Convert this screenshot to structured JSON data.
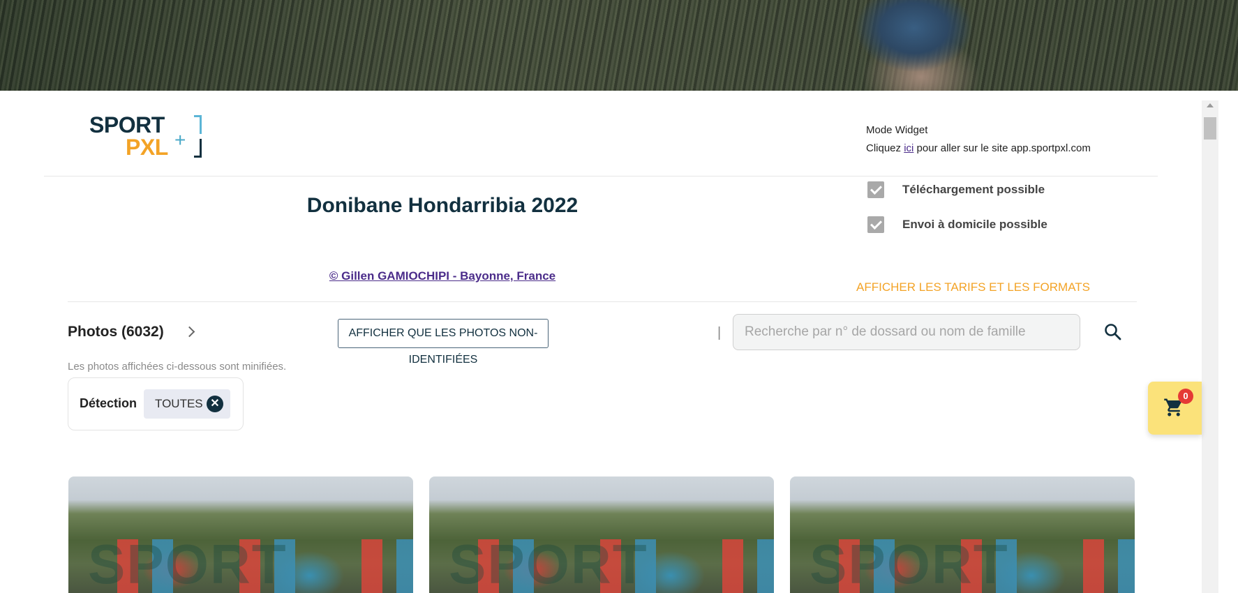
{
  "header": {
    "logo_top": "SPORT",
    "logo_bottom": "PXL",
    "logo_plus": "+",
    "mode_title": "Mode Widget",
    "mode_prefix": "Cliquez ",
    "mode_link": "ici",
    "mode_suffix": " pour aller sur le site app.sportpxl.com"
  },
  "event": {
    "title": "Donibane Hondarribia 2022",
    "credit": "© Gillen GAMIOCHIPI - Bayonne, France",
    "features": [
      {
        "label": "Téléchargement possible",
        "checked": true
      },
      {
        "label": "Envoi à domicile possible",
        "checked": true
      }
    ],
    "tarifs_link": "AFFICHER LES TARIFS ET LES FORMATS"
  },
  "photos": {
    "title": "Photos (6032)",
    "non_identified_button": "AFFICHER QUE LES PHOTOS NON-IDENTIFIÉES",
    "separator": "|",
    "search_placeholder": "Recherche par n° de dossard ou nom de famille",
    "minified_note": "Les photos affichées ci-dessous sont minifiées.",
    "detection_label": "Détection",
    "detection_chip": "TOUTES",
    "watermark": "SPORT"
  },
  "cart": {
    "count": "0"
  },
  "colors": {
    "brand_dark": "#12303f",
    "brand_orange": "#f3a326",
    "link_purple": "#4b2c8a",
    "cart_bg": "#fbe27a",
    "badge_red": "#e53935"
  }
}
